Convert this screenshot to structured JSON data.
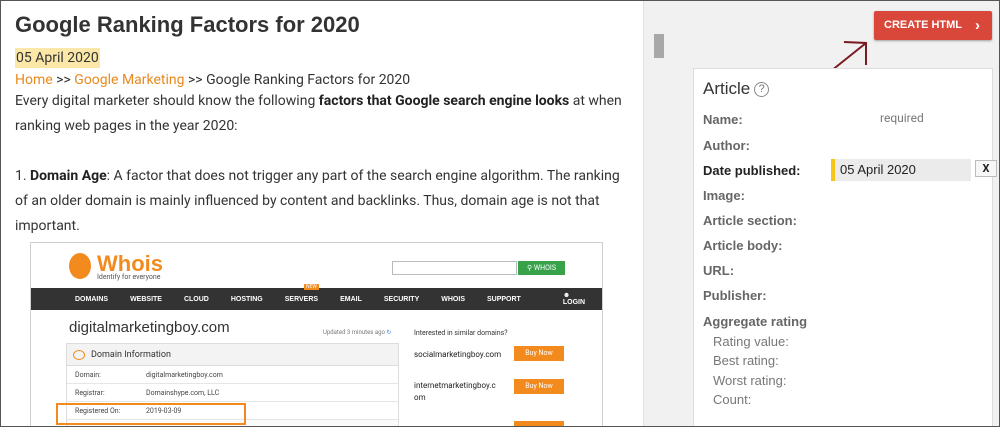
{
  "article": {
    "title": "Google Ranking Factors for 2020",
    "date": "05 April 2020",
    "breadcrumb": {
      "home": "Home",
      "sep1": " >> ",
      "category": "Google Marketing",
      "sep2": " >> ",
      "current": "Google Ranking Factors for 2020"
    },
    "intro_pre": "Every digital marketer should know the following ",
    "intro_bold": "factors that Google search engine looks",
    "intro_post": " at when ranking web pages in the year 2020:",
    "item1_num": "1. ",
    "item1_bold": "Domain Age",
    "item1_text": ": A factor that does not trigger any part of the search engine algorithm. The ranking of an older domain is mainly influenced by content and backlinks. Thus, domain age is not that important."
  },
  "whois": {
    "logo": "Whois",
    "tagline": "Identify for everyone",
    "search_btn": "WHOIS",
    "nav": [
      "DOMAINS",
      "WEBSITE",
      "CLOUD",
      "HOSTING",
      "SERVERS",
      "EMAIL",
      "SECURITY",
      "WHOIS",
      "SUPPORT"
    ],
    "new_badge": "NEW",
    "login": "LOGIN",
    "cart_count": "0",
    "domain": "digitalmarketingboy.com",
    "updated": "Updated 3 minutes ago",
    "interested": "Interested in similar domains?",
    "info_title": "Domain Information",
    "rows": [
      {
        "k": "Domain:",
        "v": "digitalmarketingboy.com"
      },
      {
        "k": "Registrar:",
        "v": "Domainshype.com, LLC"
      },
      {
        "k": "Registered On:",
        "v": "2019-03-09"
      }
    ],
    "suggestions": [
      "socialmarketingboy.com",
      "internetmarketingboy.c om"
    ],
    "buy_label": "Buy Now"
  },
  "panel": {
    "create_button": "CREATE HTML",
    "card_title": "Article",
    "help": "?",
    "fields": {
      "name": "Name:",
      "name_hint": "required",
      "author": "Author:",
      "date_published": "Date published:",
      "date_value": "05 April 2020",
      "clear": "X",
      "image": "Image:",
      "article_section": "Article section:",
      "article_body": "Article body:",
      "url": "URL:",
      "publisher": "Publisher:",
      "aggregate_rating": "Aggregate rating",
      "rating_value": "Rating value:",
      "best_rating": "Best rating:",
      "worst_rating": "Worst rating:",
      "count": "Count:"
    }
  },
  "colors": {
    "accent_orange": "#e8891e",
    "create_button": "#d9473a",
    "date_highlight": "#fbe7a7",
    "arrow": "#7a1a22"
  }
}
